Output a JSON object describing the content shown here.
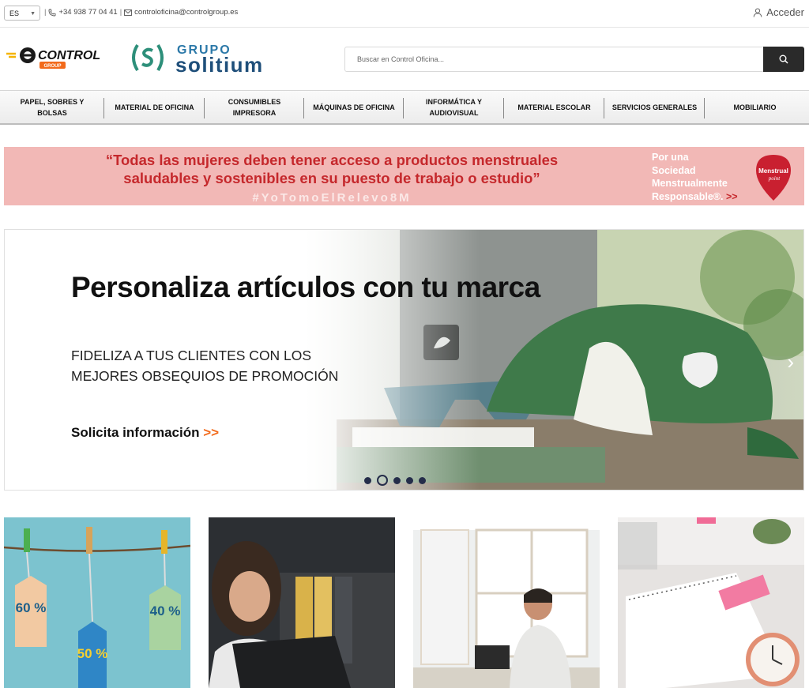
{
  "topbar": {
    "language": "ES",
    "phone": "+34 938 77 04 41",
    "email": "controloficina@controlgroup.es",
    "login_label": "Acceder"
  },
  "logos": {
    "control": "CONTROL",
    "control_sub": "GROUP",
    "solitium_top": "GRUPO",
    "solitium_bottom": "solitium"
  },
  "search": {
    "placeholder": "Buscar en Control Oficina..."
  },
  "nav": {
    "items": [
      {
        "line1": "PAPEL, SOBRES Y",
        "line2": "BOLSAS"
      },
      {
        "line1": "MATERIAL DE OFICINA",
        "line2": ""
      },
      {
        "line1": "CONSUMIBLES",
        "line2": "IMPRESORA"
      },
      {
        "line1": "MÁQUINAS DE OFICINA",
        "line2": ""
      },
      {
        "line1": "INFORMÁTICA Y",
        "line2": "AUDIOVISUAL"
      },
      {
        "line1": "MATERIAL ESCOLAR",
        "line2": ""
      },
      {
        "line1": "SERVICIOS GENERALES",
        "line2": ""
      },
      {
        "line1": "MOBILIARIO",
        "line2": ""
      }
    ]
  },
  "promo_banner": {
    "quote_line1": "“Todas las mujeres deben tener acceso a productos menstruales",
    "quote_line2": "saludables y sostenibles  en su puesto de trabajo o estudio”",
    "hashtag": "#YoTomoElRelevo8M",
    "side_line1": "Por una",
    "side_line2": "Sociedad",
    "side_line3": "Menstrualmente",
    "side_line4": "Responsable®.",
    "side_arrow": ">>",
    "badge_line1": "Menstrual",
    "badge_line2": "point"
  },
  "hero": {
    "title": "Personaliza artículos con tu marca",
    "subtitle_line1": "FIDELIZA A TUS CLIENTES CON LOS",
    "subtitle_line2": "MEJORES OBSEQUIOS DE PROMOCIÓN",
    "cta": "Solicita información",
    "cta_arrow": ">>",
    "next_arrow": "›",
    "slide_count": 5,
    "active_slide": 2
  },
  "tiles": {
    "sale_tags": [
      "60 %",
      "50 %",
      "40 %"
    ]
  },
  "colors": {
    "accent_orange": "#f26a1b",
    "banner_pink": "#f2b8b6",
    "banner_red": "#c5282c",
    "dots_navy": "#252d4a",
    "solitium_blue": "#1f4f7a"
  }
}
